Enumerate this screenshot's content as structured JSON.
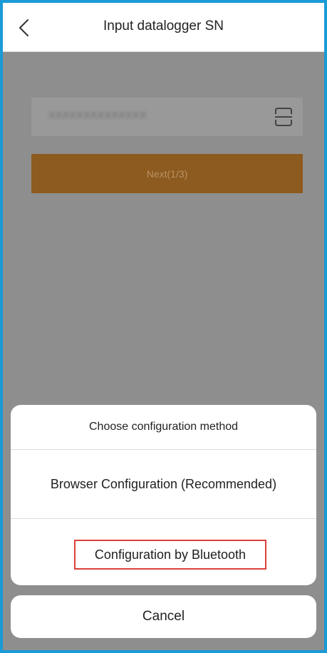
{
  "header": {
    "title": "Input datalogger SN",
    "back_icon": "chevron-left-icon"
  },
  "form": {
    "sn_value": "XXXXXXXXXXXXXX",
    "scan_icon": "scan-icon",
    "next_label": "Next(1/3)"
  },
  "sheet": {
    "title": "Choose configuration method",
    "options": [
      {
        "label": "Browser Configuration (Recommended)"
      },
      {
        "label": "Configuration by Bluetooth"
      }
    ],
    "cancel_label": "Cancel"
  },
  "colors": {
    "border_accent": "#1a9ad6",
    "overlay": "#8e8e8e",
    "next_button": "#8d5a1f",
    "highlight": "#d9403a"
  }
}
